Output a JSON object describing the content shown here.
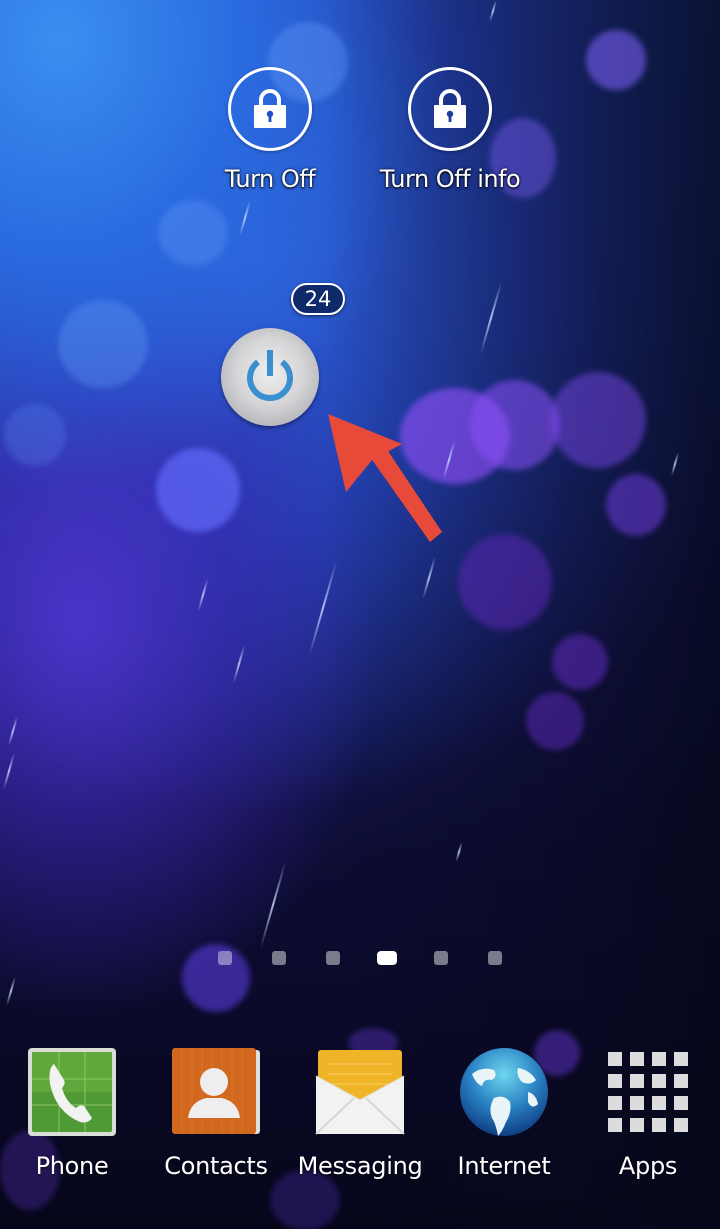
{
  "screen": "android-home-screen",
  "shortcuts": [
    {
      "label": "Turn Off",
      "icon": "lock-icon"
    },
    {
      "label": "Turn Off info",
      "icon": "lock-icon"
    }
  ],
  "power_widget": {
    "badge_count": "24",
    "icon": "power-icon",
    "accent_color": "#3a8fd0"
  },
  "annotation": {
    "type": "arrow",
    "color": "#e84a3a",
    "points_to": "power-widget"
  },
  "page_indicator": {
    "total": 6,
    "active_index": 3
  },
  "dock": {
    "items": [
      {
        "label": "Phone",
        "icon": "phone-icon"
      },
      {
        "label": "Contacts",
        "icon": "contacts-icon"
      },
      {
        "label": "Messaging",
        "icon": "messaging-icon"
      },
      {
        "label": "Internet",
        "icon": "globe-icon"
      },
      {
        "label": "Apps",
        "icon": "apps-grid-icon"
      }
    ]
  }
}
